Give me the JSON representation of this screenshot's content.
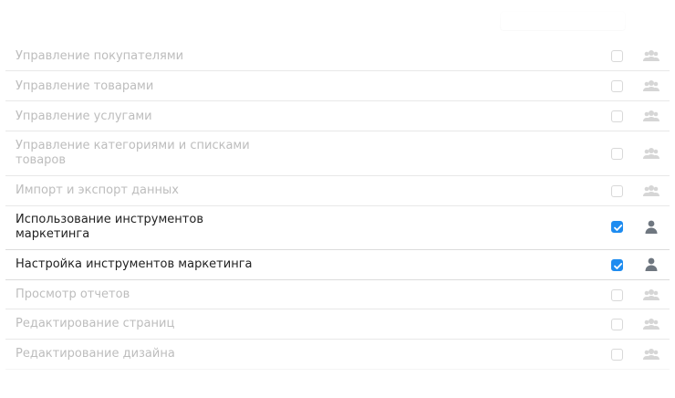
{
  "permissions": [
    {
      "label": "Управление покупателями",
      "checked": false,
      "icon": "users-group-icon",
      "active": false
    },
    {
      "label": "Управление товарами",
      "checked": false,
      "icon": "users-group-icon",
      "active": false
    },
    {
      "label": "Управление услугами",
      "checked": false,
      "icon": "users-group-icon",
      "active": false
    },
    {
      "label": "Управление категориями и списками товаров",
      "checked": false,
      "icon": "users-group-icon",
      "active": false
    },
    {
      "label": "Импорт и экспорт данных",
      "checked": false,
      "icon": "users-group-icon",
      "active": false
    },
    {
      "label": "Использование инструментов маркетинга",
      "checked": true,
      "icon": "user-icon",
      "active": true
    },
    {
      "label": "Настройка инструментов маркетинга",
      "checked": true,
      "icon": "user-icon",
      "active": true
    },
    {
      "label": "Просмотр отчетов",
      "checked": false,
      "icon": "users-group-icon",
      "active": false
    },
    {
      "label": "Редактирование страниц",
      "checked": false,
      "icon": "users-group-icon",
      "active": false
    },
    {
      "label": "Редактирование дизайна",
      "checked": false,
      "icon": "users-group-icon",
      "active": false
    }
  ],
  "colors": {
    "accent": "#1e8cf0",
    "icon_active": "#6f7780",
    "icon_inactive": "#d6d6d6"
  }
}
